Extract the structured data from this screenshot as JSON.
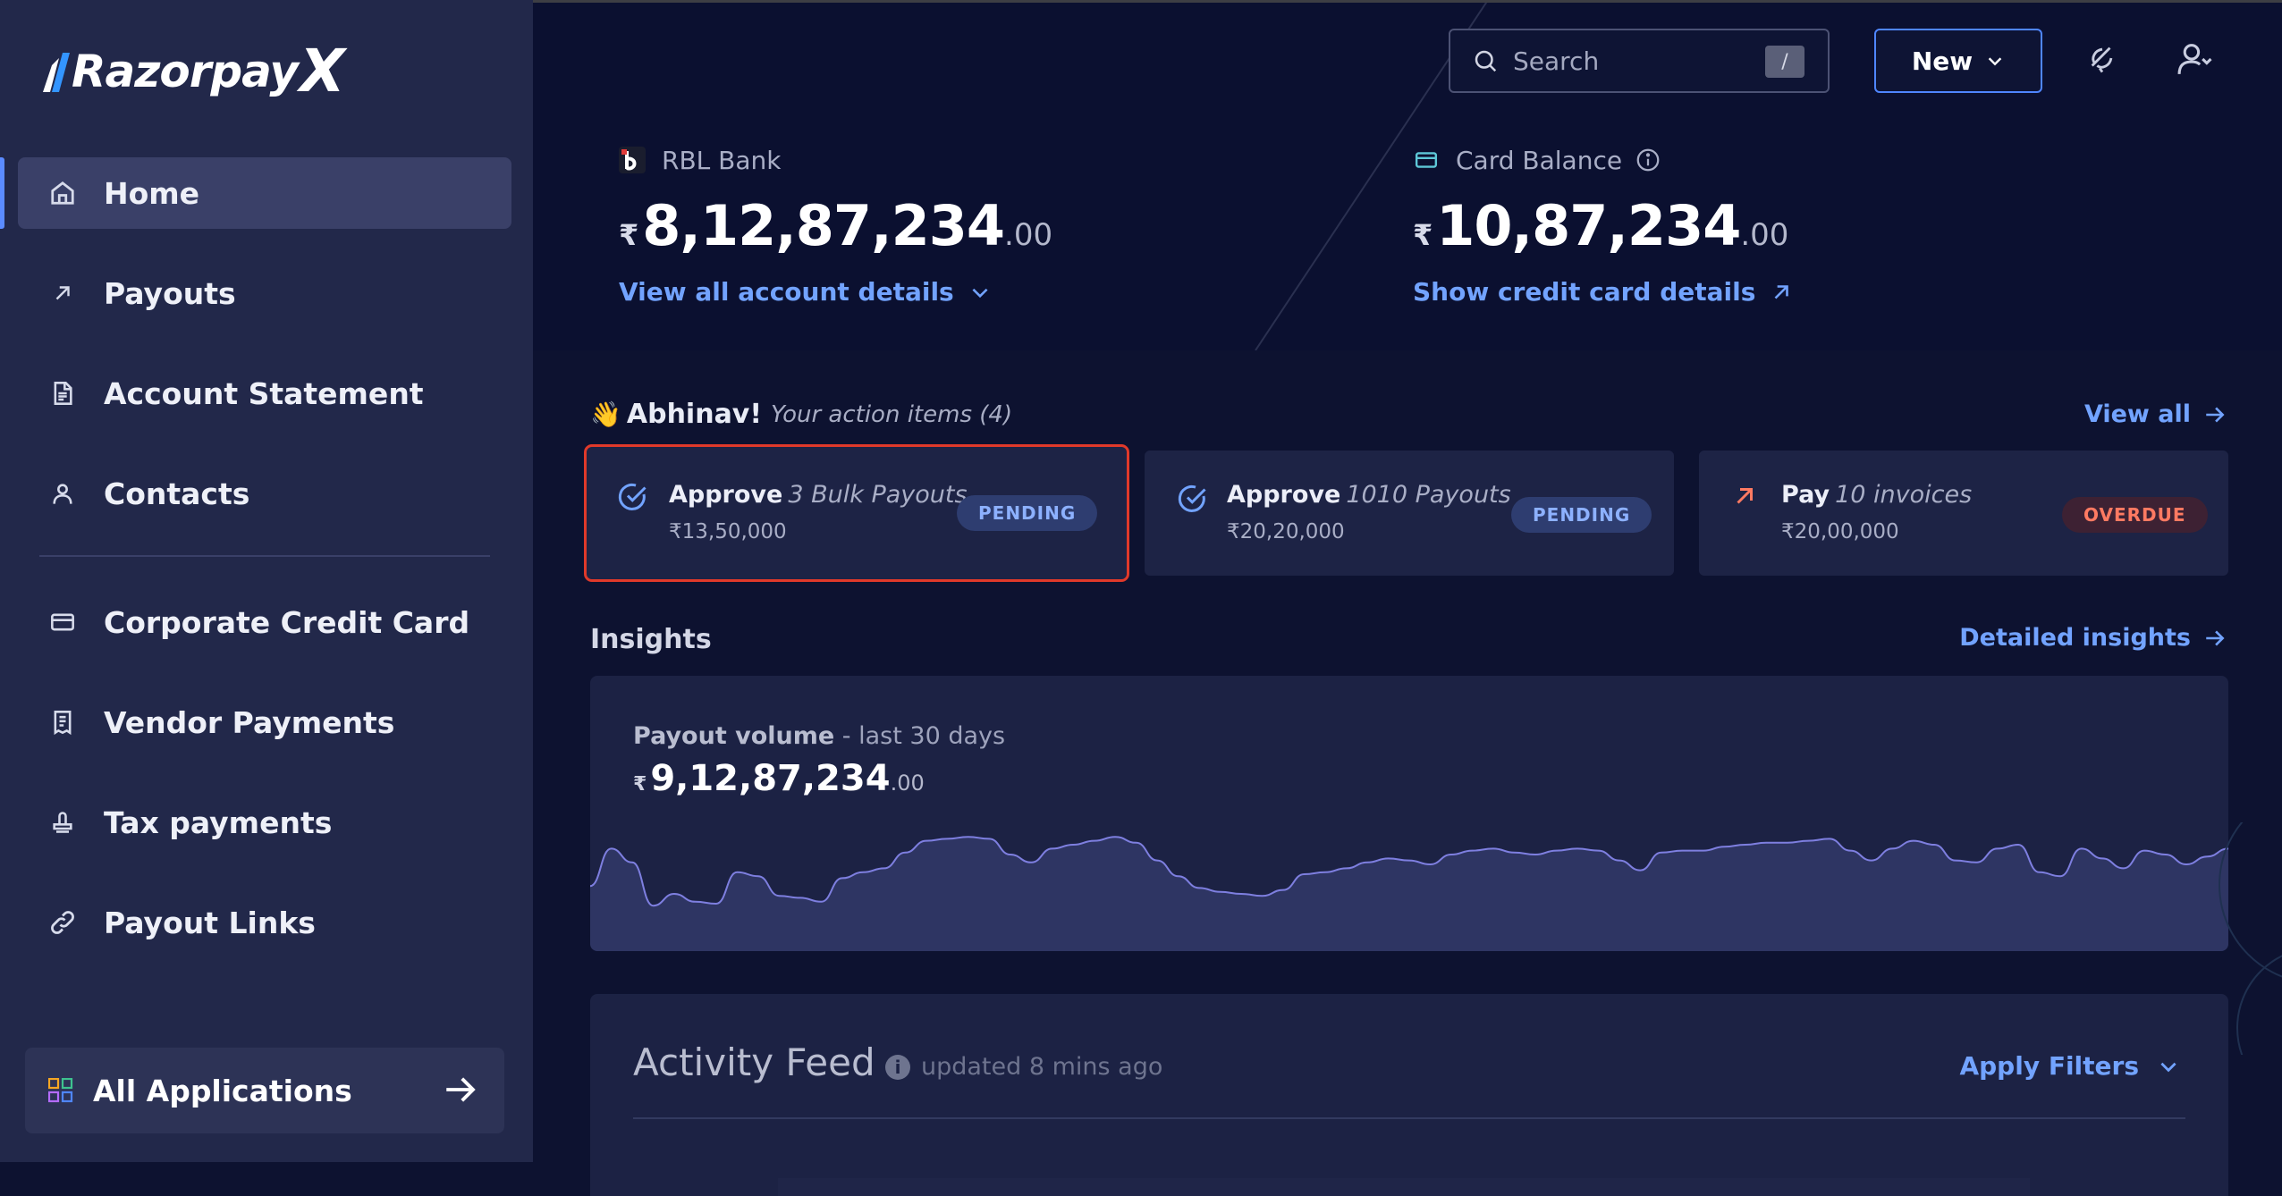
{
  "app": {
    "brand_main": "Razorpay",
    "brand_x": "X"
  },
  "sidebar": {
    "items": [
      {
        "label": "Home",
        "icon": "home-icon",
        "active": true
      },
      {
        "label": "Payouts",
        "icon": "arrow-up-right-icon"
      },
      {
        "label": "Account Statement",
        "icon": "document-icon"
      },
      {
        "label": "Contacts",
        "icon": "user-icon"
      },
      {
        "label": "Corporate Credit Card",
        "icon": "credit-card-icon"
      },
      {
        "label": "Vendor Payments",
        "icon": "receipt-icon"
      },
      {
        "label": "Tax payments",
        "icon": "stamp-icon"
      },
      {
        "label": "Payout Links",
        "icon": "link-icon"
      }
    ],
    "all_applications": "All Applications"
  },
  "header": {
    "search_placeholder": "Search",
    "search_shortcut": "/",
    "new_label": "New"
  },
  "accounts": {
    "bank": {
      "name": "RBL Bank",
      "currency": "₹",
      "amount": "8,12,87,234",
      "decimal": ".00",
      "link": "View all account details"
    },
    "card": {
      "name": "Card Balance",
      "currency": "₹",
      "amount": "10,87,234",
      "decimal": ".00",
      "link": "Show credit card details"
    }
  },
  "actions": {
    "wave": "👋",
    "greeting": "Abhinav!",
    "subtitle": "Your action items (4)",
    "view_all": "View all",
    "items": [
      {
        "verb": "Approve",
        "detail": "3 Bulk Payouts",
        "amount": "₹13,50,000",
        "status": "PENDING"
      },
      {
        "verb": "Approve",
        "detail": "1010 Payouts",
        "amount": "₹20,20,000",
        "status": "PENDING"
      },
      {
        "verb": "Pay",
        "detail": "10 invoices",
        "amount": "₹20,00,000",
        "status": "OVERDUE"
      }
    ]
  },
  "insights": {
    "title": "Insights",
    "detailed_link": "Detailed insights",
    "metric_label": "Payout volume",
    "metric_period": " - last 30 days",
    "currency": "₹",
    "amount": "9,12,87,234",
    "decimal": ".00"
  },
  "activity": {
    "title": "Activity Feed",
    "updated": "updated 8 mins ago",
    "filters": "Apply Filters"
  },
  "colors": {
    "accent": "#72a3ff",
    "pending": "#8db1ff",
    "overdue": "#ff7a62",
    "highlight": "#e0392a"
  },
  "chart_data": {
    "type": "area",
    "title": "Payout volume",
    "series": [
      {
        "values": [
          48,
          86,
          72,
          28,
          40,
          32,
          30,
          62,
          58,
          38,
          36,
          32,
          56,
          62,
          66,
          82,
          94,
          96,
          98,
          96,
          80,
          72,
          86,
          90,
          94,
          98,
          92,
          74,
          58,
          46,
          42,
          40,
          38,
          44,
          60,
          62,
          66,
          72,
          76,
          74,
          70,
          80,
          84,
          86,
          82,
          80,
          84,
          86,
          84,
          74,
          64,
          82,
          84,
          84,
          88,
          90,
          92,
          92,
          94,
          96,
          84,
          74,
          86,
          94,
          90,
          74,
          72,
          86,
          90,
          62,
          58,
          86,
          76,
          66,
          84,
          80,
          70,
          78,
          86
        ]
      }
    ]
  }
}
